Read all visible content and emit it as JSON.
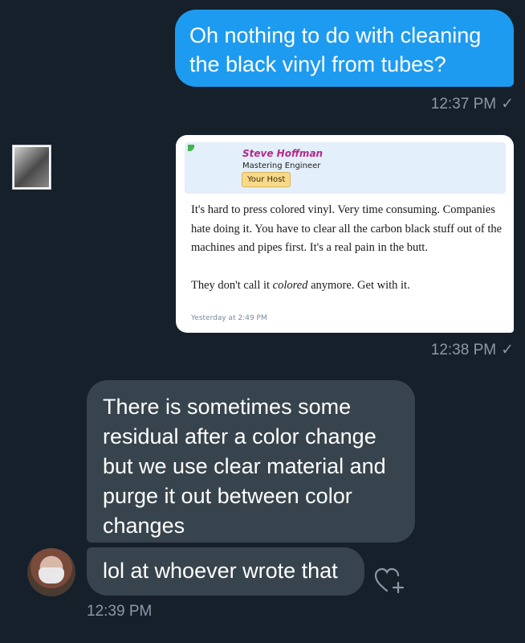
{
  "messages": {
    "outgoing_1": {
      "text": "Oh nothing to do with cleaning the black vinyl from tubes?",
      "time": "12:37 PM",
      "status_icon": "check-icon"
    },
    "outgoing_2": {
      "time": "12:38 PM",
      "status_icon": "check-icon",
      "embed": {
        "poster_name": "Steve Hoffman",
        "poster_title": "Mastering Engineer",
        "badge": "Your Host",
        "paragraph_1": "It's hard to press colored vinyl. Very time consuming. Companies hate doing it. You have to clear all the carbon black stuff out of the machines and pipes first. It's a real pain in the butt.",
        "paragraph_2_before": "They don't call it ",
        "paragraph_2_italic": "colored",
        "paragraph_2_after": " anymore. Get with it.",
        "date": "Yesterday at 2:49 PM"
      }
    },
    "incoming_1": {
      "text": "There is sometimes some residual after a color change but we use clear material and purge it out between color changes"
    },
    "incoming_2": {
      "text": "lol at whoever wrote that",
      "time": "12:39 PM"
    }
  },
  "check_glyph": "✓",
  "colors": {
    "background": "#15202b",
    "outgoing_bubble": "#1d9bf0",
    "incoming_bubble": "#38444d",
    "meta_text": "#8b98a5"
  }
}
